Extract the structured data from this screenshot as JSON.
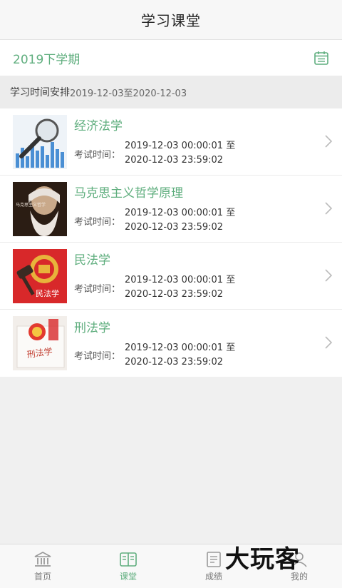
{
  "header": {
    "title": "学习课堂"
  },
  "semester": {
    "label": "2019下学期",
    "icon": "calendar-icon"
  },
  "schedule": {
    "prefix": "学习时间安排",
    "range": "2019-12-03至2020-12-03"
  },
  "courses": [
    {
      "name": "经济法学",
      "exam_label": "考试时间：",
      "exam_start": "2019-12-03 00:00:01 至",
      "exam_end": "2020-12-03 23:59:02",
      "thumb": "magnifier-chart-image"
    },
    {
      "name": "马克思主义哲学原理",
      "exam_label": "考试时间：",
      "exam_start": "2019-12-03 00:00:01 至",
      "exam_end": "2020-12-03 23:59:02",
      "thumb": "portrait-image",
      "thumb_text": "马克思主义哲学"
    },
    {
      "name": "民法学",
      "exam_label": "考试时间：",
      "exam_start": "2019-12-03 00:00:01 至",
      "exam_end": "2020-12-03 23:59:02",
      "thumb": "emblem-gavel-image",
      "thumb_text": "民法学"
    },
    {
      "name": "刑法学",
      "exam_label": "考试时间：",
      "exam_start": "2019-12-03 00:00:01 至",
      "exam_end": "2020-12-03 23:59:02",
      "thumb": "emblem-book-image",
      "thumb_text": "刑法学"
    }
  ],
  "tabbar": [
    {
      "label": "首页",
      "icon": "home-bank-icon",
      "active": false
    },
    {
      "label": "课堂",
      "icon": "book-icon",
      "active": true
    },
    {
      "label": "成绩",
      "icon": "report-icon",
      "active": false
    },
    {
      "label": "我的",
      "icon": "profile-icon",
      "active": false
    }
  ],
  "watermark": {
    "text": "大玩客"
  },
  "colors": {
    "accent": "#5fae7e",
    "inactive": "#999999"
  }
}
